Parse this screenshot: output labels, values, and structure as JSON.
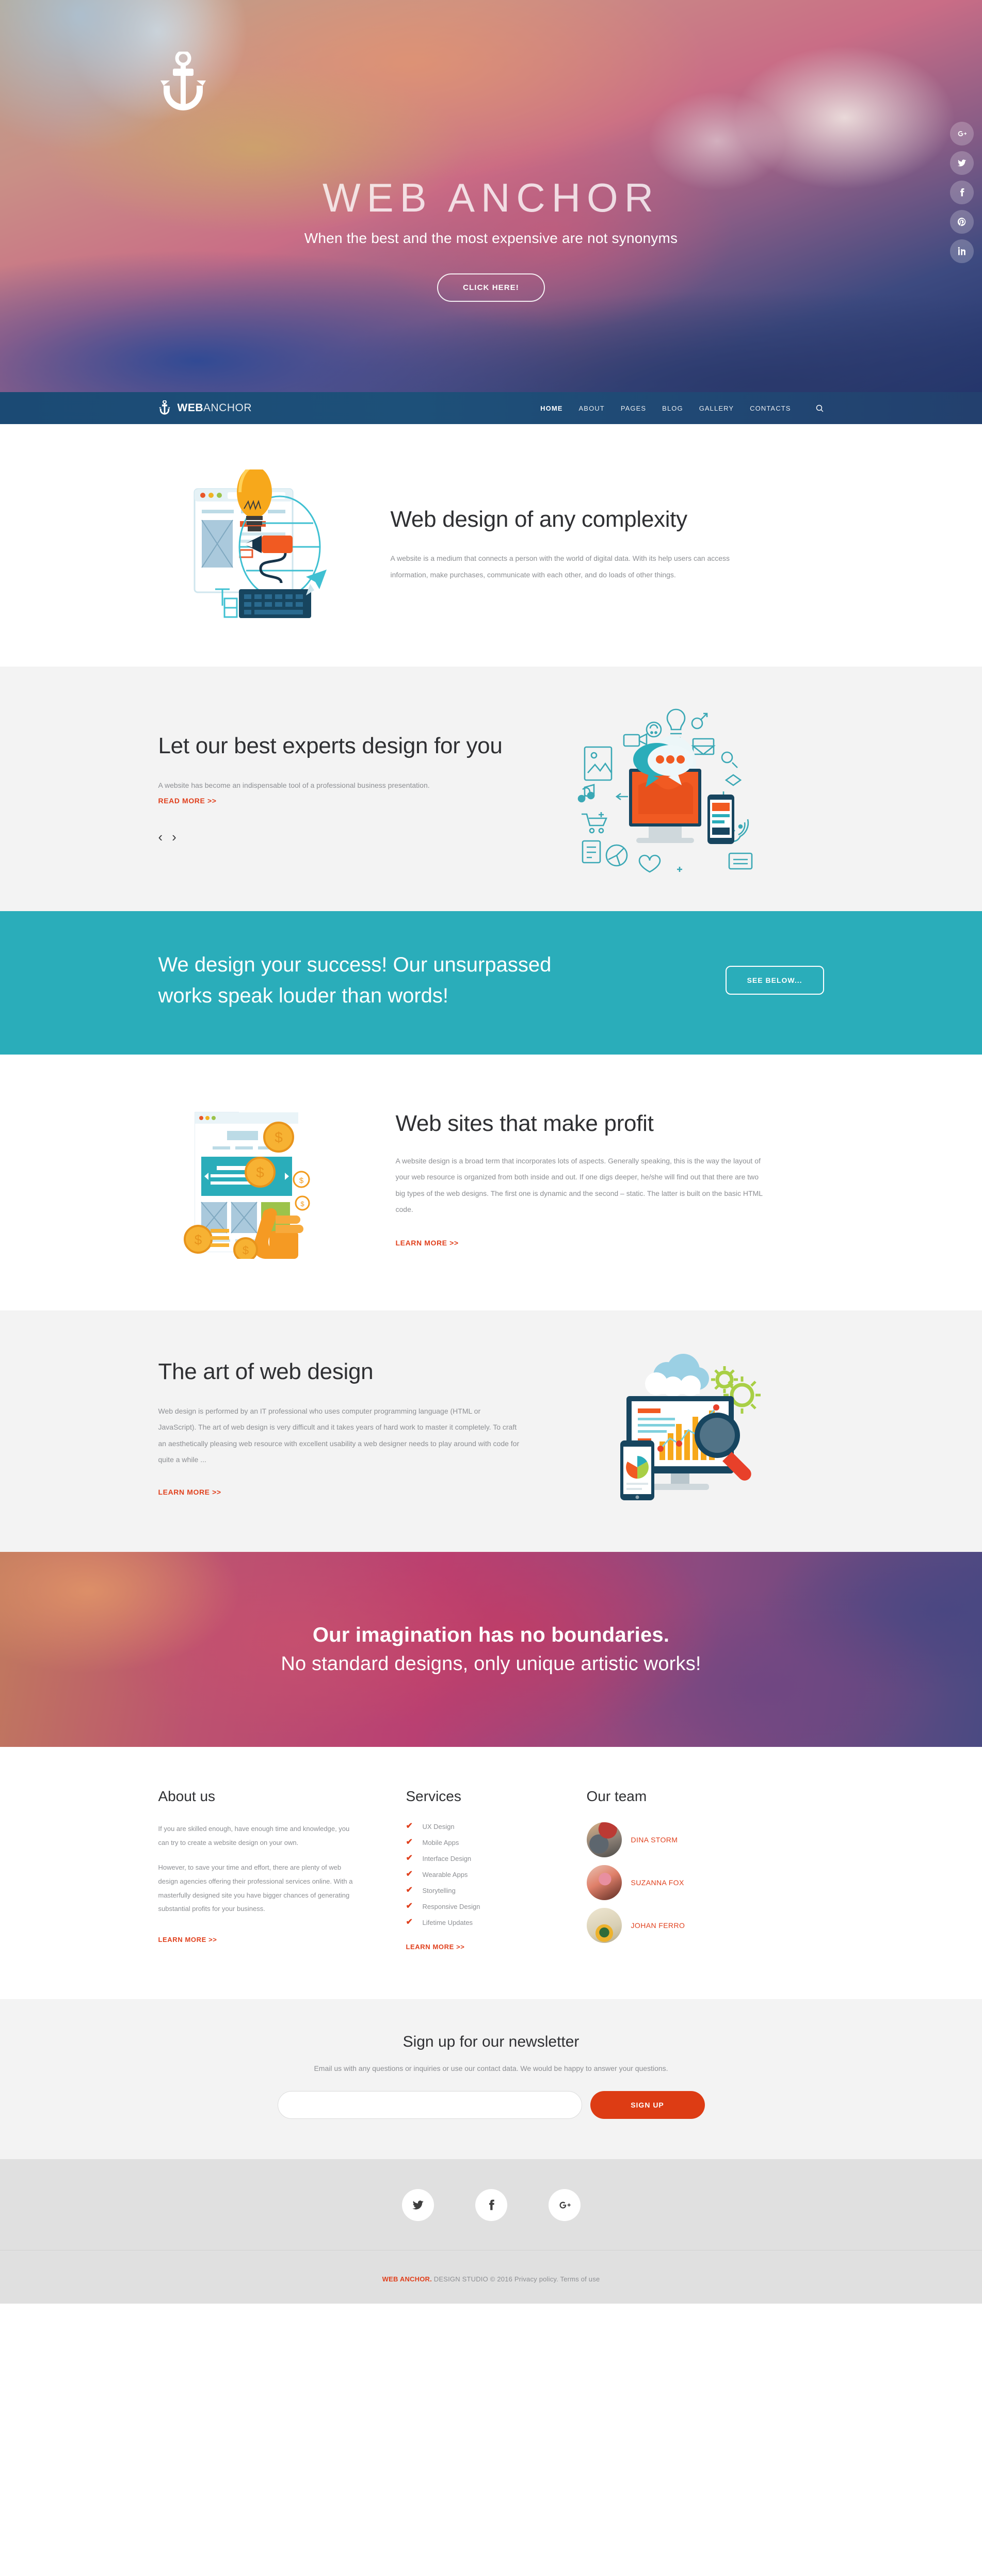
{
  "hero": {
    "logo_icon": "anchor-icon",
    "title_bold": "WEB",
    "title_light": " ANCHOR",
    "subtitle": "When the best and the most expensive are not synonyms",
    "cta": "CLICK HERE!",
    "social": [
      {
        "name": "google-plus-icon",
        "label": "G+"
      },
      {
        "name": "twitter-icon",
        "label": "Twitter"
      },
      {
        "name": "facebook-icon",
        "label": "Facebook"
      },
      {
        "name": "pinterest-icon",
        "label": "Pinterest"
      },
      {
        "name": "linkedin-icon",
        "label": "in"
      }
    ]
  },
  "nav": {
    "brand_bold": "WEB",
    "brand_light": "ANCHOR",
    "links": [
      {
        "label": "HOME",
        "active": true
      },
      {
        "label": "ABOUT",
        "active": false
      },
      {
        "label": "PAGES",
        "active": false
      },
      {
        "label": "BLOG",
        "active": false
      },
      {
        "label": "GALLERY",
        "active": false
      },
      {
        "label": "CONTACTS",
        "active": false
      }
    ],
    "search_icon": "search-icon"
  },
  "section_complexity": {
    "heading": "Web design of any complexity",
    "body": "A website is a medium that connects a person with the world of digital data. With its help users can access information, make purchases, communicate with each other, and do loads of other things."
  },
  "section_experts": {
    "heading": "Let our best experts design for you",
    "body": "A website has become an indispensable tool of a professional business presentation.",
    "read_more": "READ MORE >>",
    "prev_arrow": "‹",
    "next_arrow": "›"
  },
  "banner_teal": {
    "heading": "We design your success! Our unsurpassed works speak louder than words!",
    "button": "SEE BELOW...",
    "color": "#2aadba"
  },
  "section_profit": {
    "heading": "Web sites that make profit",
    "body": "A website design is a broad term that incorporates lots of aspects. Generally speaking, this is the way the layout of your web resource is organized from both inside and out. If one digs deeper, he/she will find out that there are two big types of the web designs. The first one is dynamic and the second – static. The latter is built on the basic HTML code.",
    "learn_more": "LEARN MORE >>"
  },
  "section_art": {
    "heading": "The art of web design",
    "body": "Web design is performed by an IT professional who uses computer programming language (HTML or JavaScript). The art of web design is very difficult and it takes years of hard work to master it completely. To craft an aesthetically pleasing web resource with excellent usability a web designer needs to play around with code for quite a while ...",
    "learn_more": "LEARN MORE >>"
  },
  "banner_imagination": {
    "line1": "Our imagination has no boundaries.",
    "line2": "No standard designs, only unique artistic works!"
  },
  "columns": {
    "about": {
      "title": "About us",
      "p1": "If you are skilled enough, have enough time and knowledge, you can try to create a website design on your own.",
      "p2": "However, to save your time and effort, there are plenty of web design agencies offering their professional services online. With a masterfully designed site you have bigger chances of generating substantial profits for your business.",
      "learn_more": "LEARN MORE >>"
    },
    "services": {
      "title": "Services",
      "items": [
        "UX Design",
        "Mobile Apps",
        "Interface Design",
        "Wearable Apps",
        "Storytelling",
        "Responsive Design",
        "Lifetime Updates"
      ],
      "learn_more": "LEARN MORE >>"
    },
    "team": {
      "title": "Our team",
      "members": [
        {
          "name": "DINA STORM"
        },
        {
          "name": "SUZANNA FOX"
        },
        {
          "name": "JOHAN FERRO"
        }
      ]
    }
  },
  "newsletter": {
    "title": "Sign up for our newsletter",
    "subtitle": "Email us with any questions or inquiries or use our contact data. We would be happy to answer your questions.",
    "input_placeholder": "",
    "input_value": "",
    "button": "SIGN UP"
  },
  "footer": {
    "social": [
      {
        "name": "twitter-icon"
      },
      {
        "name": "facebook-icon"
      },
      {
        "name": "google-plus-icon"
      }
    ],
    "copyright_brand": "WEB ANCHOR.",
    "copyright_rest": " DESIGN STUDIO © 2016 Privacy policy. Terms of use"
  },
  "colors": {
    "accent_orange": "#e0401d",
    "teal": "#2aadba",
    "nav_blue": "#1d5079",
    "gray_section": "#f3f3f3",
    "footer_gray": "#e0e0e0"
  }
}
